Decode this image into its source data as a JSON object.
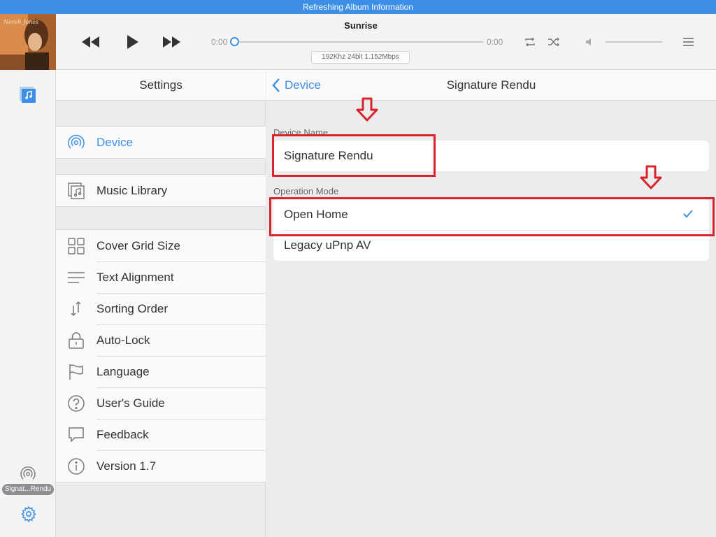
{
  "status_bar": {
    "text": "Refreshing Album Information"
  },
  "player": {
    "track_title": "Sunrise",
    "elapsed": "0:00",
    "remaining": "0:00",
    "progress_fraction": 0,
    "format_info": "192Khz  24bit  1.152Mbps",
    "cover_art_text": "Norah Jones",
    "icons": [
      "rewind-icon",
      "play-icon",
      "fast-forward-icon",
      "repeat-icon",
      "shuffle-icon",
      "volume-icon",
      "menu-icon"
    ]
  },
  "rail": {
    "device_badge": "Signat...Rendu",
    "icons": [
      "music-library-icon",
      "device-icon",
      "gear-icon"
    ]
  },
  "settings": {
    "title": "Settings",
    "groups": [
      [
        {
          "label": "Device",
          "icon": "device-icon",
          "active": true
        }
      ],
      [
        {
          "label": "Music Library",
          "icon": "music-library-icon"
        }
      ],
      [
        {
          "label": "Cover Grid Size",
          "icon": "grid-icon"
        },
        {
          "label": "Text Alignment",
          "icon": "text-align-icon"
        },
        {
          "label": "Sorting Order",
          "icon": "sort-icon"
        },
        {
          "label": "Auto-Lock",
          "icon": "lock-icon"
        },
        {
          "label": "Language",
          "icon": "flag-icon"
        },
        {
          "label": "User's Guide",
          "icon": "help-icon"
        },
        {
          "label": "Feedback",
          "icon": "feedback-icon"
        },
        {
          "label": "Version 1.7",
          "icon": "info-icon"
        }
      ]
    ]
  },
  "detail": {
    "back_label": "Device",
    "title": "Signature Rendu",
    "device_name_label": "Device Name",
    "device_name_value": "Signature Rendu",
    "operation_mode_label": "Operation Mode",
    "modes": [
      {
        "label": "Open Home",
        "selected": true
      },
      {
        "label": "Legacy uPnp AV",
        "selected": false
      }
    ]
  },
  "colors": {
    "accent": "#3d8ee6",
    "annotation": "#d8232a",
    "status_bar": "#3d8ee6"
  }
}
